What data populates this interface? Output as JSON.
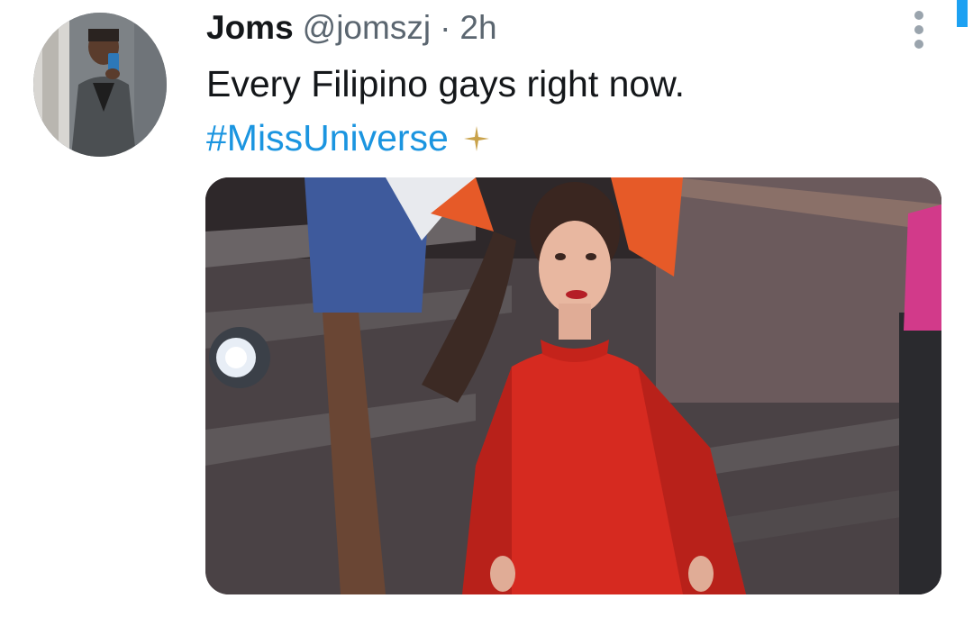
{
  "tweet": {
    "author_name": "Joms",
    "handle": "@jomszj",
    "separator": "·",
    "time": "2h",
    "text": "Every Filipino gays right now.",
    "hashtag": "#MissUniverse",
    "hashtag_emoji_icon": "sparkle-icon",
    "menu_icon": "more-vertical-icon"
  },
  "colors": {
    "text": "#14171a",
    "secondary_text": "#5b6670",
    "link": "#1b95e0",
    "dress": "#d62a20",
    "sparkle": "#c9a24a"
  }
}
